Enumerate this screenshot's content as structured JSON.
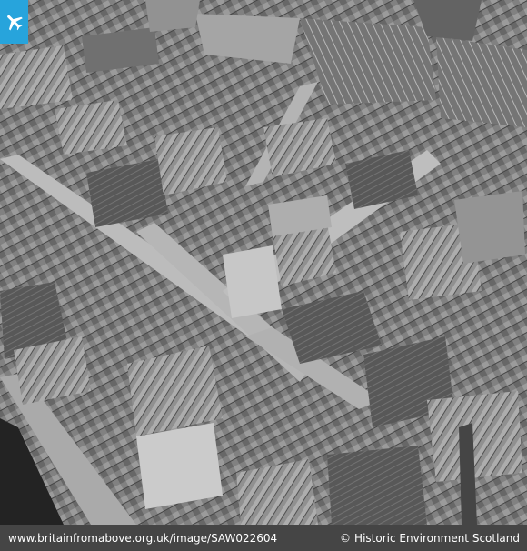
{
  "footer": {
    "image_url": "www.britainfromabove.org.uk/image/SAW022604",
    "copyright_symbol": "©",
    "credit": "Historic Environment Scotland"
  },
  "badge": {
    "icon": "airplane-icon",
    "color": "#27a4dc"
  },
  "photo": {
    "description_icon": "aerial-photograph"
  }
}
